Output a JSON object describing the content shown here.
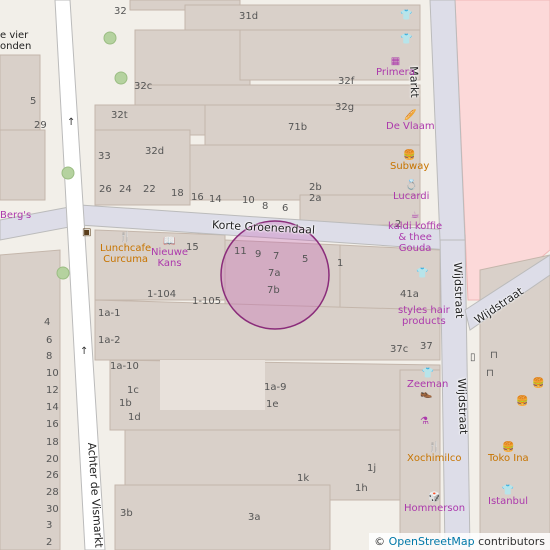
{
  "map": {
    "colors": {
      "background": "#f2efe9",
      "building": "#d9d0c9",
      "building_stroke": "#c4b6ab",
      "road": "#ffffff",
      "road_casing": "#bbb",
      "pedestrian": "#dddde8",
      "construction": "#fcd9d9",
      "highlight_fill": "#c85ab4",
      "highlight_stroke": "#8a2c7a",
      "shop_pink": "#ac39ac",
      "food_orange": "#c77400"
    },
    "streets": {
      "korte_groenendaal": "Korte Groenendaal",
      "markt": "Markt",
      "wijdstraat_left": "Wijdstraat",
      "wijdstraat_right": "Wijdstraat",
      "achter_de_vismarkt": "Achter de Vismarkt"
    },
    "house_numbers": [
      "32",
      "31d",
      "32f",
      "32c",
      "32g",
      "32t",
      "71b",
      "32d",
      "33",
      "26",
      "24",
      "22",
      "18",
      "16",
      "14",
      "10",
      "8",
      "6",
      "2b",
      "2a",
      "2",
      "11",
      "9",
      "7",
      "7a",
      "7b",
      "5",
      "1",
      "15",
      "1-104",
      "1-105",
      "41a",
      "1a-1",
      "1a-2",
      "37c",
      "37",
      "1a-10",
      "1a-9",
      "1c",
      "1b",
      "1e",
      "1d",
      "1j",
      "1k",
      "1h",
      "3a",
      "3b",
      "4",
      "6",
      "8",
      "10",
      "12",
      "14",
      "16",
      "18",
      "20",
      "26",
      "28",
      "30",
      "3",
      "2",
      "5",
      "29"
    ],
    "pois": {
      "primera": "Primera",
      "de_vlaam": "De Vlaam",
      "subway": "Subway",
      "lucardi": "Lucardi",
      "kaldi": "kaldi koffie\n& thee",
      "gouda": "Gouda",
      "styles": "styles hair\nproducts",
      "zeeman": "Zeeman",
      "xochimilco": "Xochimilco",
      "toko_ina": "Toko Ina",
      "hommerson": "Hommerson",
      "istanbul": "Istanbul",
      "lunchcafe": "Lunchcafe\nCurcuma",
      "nieuwe_kans": "Nieuwe\nKans",
      "bergs": "Berg's",
      "de_vier": "e vier\nonden",
      "wijdstraat_label": "Wijdstraat"
    },
    "icons": {
      "clothes": "clothes-icon",
      "shop": "shop-icon",
      "bakery": "bakery-icon",
      "fastfood": "fastfood-icon",
      "jewellery": "jewellery-icon",
      "coffee": "coffee-icon",
      "hair": "hair-icon",
      "shoes": "shoes-icon",
      "restaurant": "restaurant-icon",
      "books": "books-icon",
      "chemist": "chemist-icon",
      "gift": "gift-icon",
      "tree": "tree-icon",
      "arrow": "oneway-arrow-icon",
      "bench": "bench-icon"
    },
    "attribution": {
      "prefix": "© ",
      "link": "OpenStreetMap",
      "suffix": " contributors"
    }
  }
}
